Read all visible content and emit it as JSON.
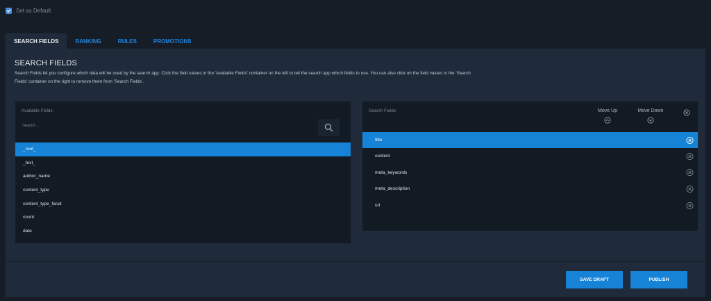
{
  "default_toggle": {
    "label": "Set as Default",
    "checked": true
  },
  "tabs": [
    {
      "label": "SEARCH FIELDS",
      "active": true
    },
    {
      "label": "RANKING",
      "active": false
    },
    {
      "label": "RULES",
      "active": false
    },
    {
      "label": "PROMOTIONS",
      "active": false
    }
  ],
  "section": {
    "title": "SEARCH FIELDS",
    "description": "Search Fields let you configure which data will be used by the search app. Click the field values in the 'Available Fields' container on the left to tell the search app which fields to use. You can also click on the field values in the 'Search Fields' container on the right to remove them from 'Search Fields'."
  },
  "available": {
    "label": "Available Fields",
    "search_placeholder": "Search...",
    "items": [
      "_root_",
      "_text_",
      "author_name",
      "content_type",
      "content_type_facet",
      "count",
      "date"
    ],
    "selected_index": 0
  },
  "search_fields": {
    "label": "Search Fields",
    "move_up_label": "Move Up",
    "move_down_label": "Move Down",
    "items": [
      "title",
      "content",
      "meta_keywords",
      "meta_description",
      "url"
    ],
    "selected_index": 0
  },
  "actions": {
    "save_draft": "SAVE DRAFT",
    "publish": "PUBLISH"
  },
  "colors": {
    "accent": "#1683d6",
    "background": "#171d26",
    "panel": "#1f2b3a",
    "box": "#121a24"
  }
}
